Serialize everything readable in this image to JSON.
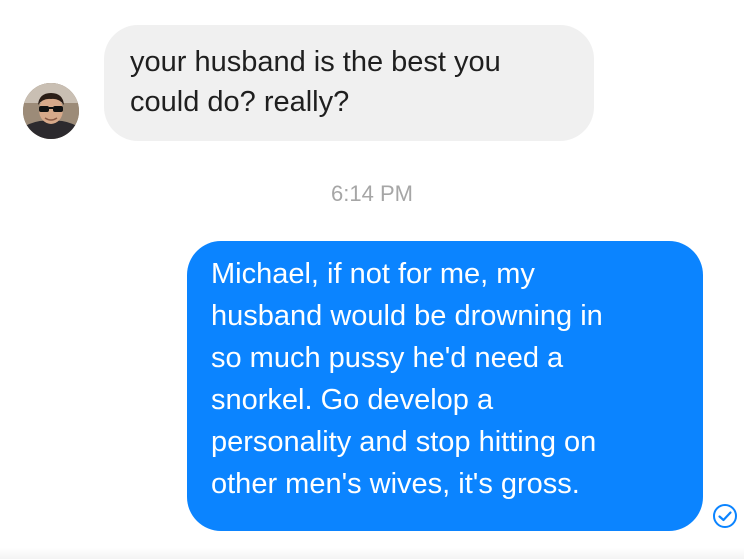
{
  "conversation": {
    "incoming": {
      "avatar_icon": "person-avatar-icon",
      "text": "your husband is the best you\ncould do? really?"
    },
    "timestamp": "6:14 PM",
    "outgoing": {
      "text": "Michael, if not for me, my\nhusband would be drowning in\nso much pussy he'd need a\nsnorkel. Go develop a\npersonality and stop hitting on\nother men's wives, it's gross.",
      "status_icon": "delivered-check-icon"
    }
  },
  "colors": {
    "incoming_bubble": "#f0f0f0",
    "outgoing_bubble": "#0b84ff",
    "timestamp_text": "#a6a6a6",
    "receipt_icon": "#0b84ff"
  }
}
